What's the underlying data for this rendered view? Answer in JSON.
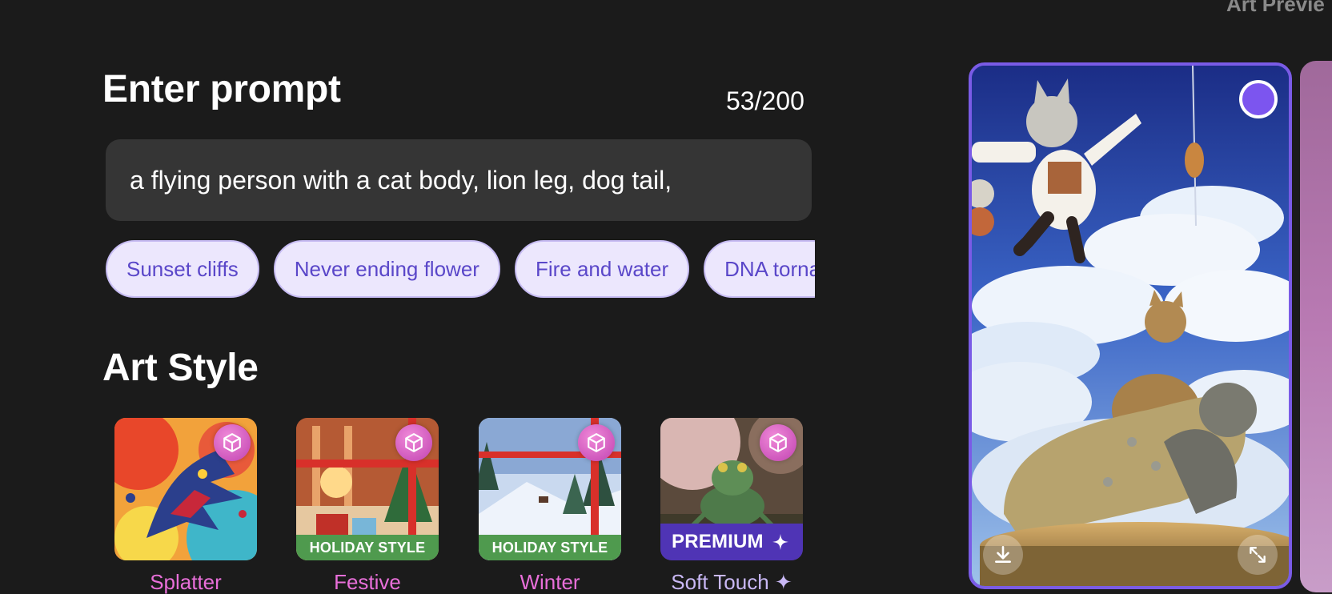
{
  "header": {
    "preview_heading": "Art Previe"
  },
  "prompt": {
    "title": "Enter prompt",
    "counter": "53/200",
    "value": "a flying person with a cat body, lion leg, dog tail,"
  },
  "suggestions": [
    "Sunset cliffs",
    "Never ending flower",
    "Fire and water",
    "DNA torna"
  ],
  "art_style": {
    "title": "Art Style",
    "items": [
      {
        "label": "Splatter",
        "badge": "",
        "icon": "cube-icon"
      },
      {
        "label": "Festive",
        "badge": "HOLIDAY STYLE",
        "icon": "cube-icon"
      },
      {
        "label": "Winter",
        "badge": "HOLIDAY STYLE",
        "icon": "cube-icon"
      },
      {
        "label": "Soft Touch ✦",
        "badge": "PREMIUM",
        "badge_icon": "sparkle-icon",
        "icon": "cube-icon"
      }
    ]
  },
  "preview": {
    "selected": true,
    "actions": [
      "download-icon",
      "expand-icon"
    ]
  },
  "colors": {
    "background": "#1b1b1b",
    "accent": "#7a5be6",
    "chip_bg": "#ece7fd",
    "chip_text": "#5a47c9",
    "style_label": "#e86fd9",
    "holiday_banner": "#4f9a4e",
    "premium_banner": "#4f34b5"
  }
}
